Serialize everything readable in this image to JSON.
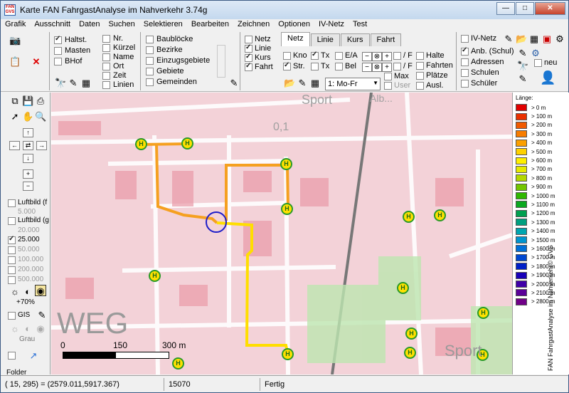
{
  "window": {
    "title": "Karte FAN FahrgastAnalyse im Nahverkehr 3.74g",
    "app_icon_text": "FAN GVS",
    "minimize": "—",
    "maximize": "□",
    "close": "✕"
  },
  "menu": [
    "Grafik",
    "Ausschnitt",
    "Daten",
    "Suchen",
    "Selektieren",
    "Bearbeiten",
    "Zeichnen",
    "Optionen",
    "IV-Netz",
    "Test"
  ],
  "toolbar": {
    "group1": [
      {
        "label": "Haltst.",
        "checked": true
      },
      {
        "label": "Masten",
        "checked": false
      },
      {
        "label": "BHof",
        "checked": false
      }
    ],
    "group2": [
      {
        "label": "Nr.",
        "checked": false
      },
      {
        "label": "Kürzel",
        "checked": false
      },
      {
        "label": "Name",
        "checked": false
      },
      {
        "label": "Ort",
        "checked": false
      },
      {
        "label": "Zeit",
        "checked": false
      },
      {
        "label": "Linien",
        "checked": false
      }
    ],
    "group3": [
      {
        "label": "Baublöcke",
        "checked": false
      },
      {
        "label": "Bezirke",
        "checked": false
      },
      {
        "label": "Einzugsgebiete",
        "checked": false
      },
      {
        "label": "Gebiete",
        "checked": false
      },
      {
        "label": "Gemeinden",
        "checked": false
      }
    ],
    "group4": [
      {
        "label": "Netz",
        "checked": false
      },
      {
        "label": "Linie",
        "checked": true
      },
      {
        "label": "Kurs",
        "checked": true
      },
      {
        "label": "Fahrt",
        "checked": true
      }
    ],
    "tabs": [
      "Netz",
      "Linie",
      "Kurs",
      "Fahrt"
    ],
    "tab_active": "Netz",
    "netz_options": {
      "kno": "Kno",
      "str": "Str.",
      "tx1": "Tx",
      "tx2": "Tx",
      "ea": "E/A",
      "bel": "Bel",
      "f1": "/ F",
      "f2": "/ F",
      "max": "Max",
      "user": "User",
      "halte": "Halte",
      "fahrten": "Fahrten",
      "platze": "Plätze",
      "ausl": "Ausl."
    },
    "day_select": "1: Mo-Fr",
    "group5": [
      {
        "label": "IV-Netz",
        "checked": false
      },
      {
        "label": "Anb. (Schul)",
        "checked": true
      },
      {
        "label": "Adressen",
        "checked": false
      },
      {
        "label": "Schulen",
        "checked": false
      },
      {
        "label": "Schüler",
        "checked": false
      }
    ],
    "neu_label": "neu"
  },
  "sidebar": {
    "luftbild1": "Luftbild (f",
    "scale_5000": "5.000",
    "luftbild2": "Luftbild (g",
    "scale_20000": "20.000",
    "scale_25000": "25.000",
    "scale_50000": "50.000",
    "scale_100000": "100.000",
    "scale_200000": "200.000",
    "scale_500000": "500.000",
    "contrast": "+70%",
    "gis": "GIS",
    "grau": "Grau",
    "folder": "Folder"
  },
  "map": {
    "labels": {
      "sport_top": "Sport",
      "sport_bottom": "Sport",
      "weg": "WEG",
      "top_text": "Alb...",
      "km": "0,1"
    },
    "scalebar": {
      "t0": "0",
      "t150": "150",
      "t300": "300 m"
    }
  },
  "legend": {
    "title": "Länge:",
    "vertical_text": "FAN FahrgastAnalyse im Nahverkehr© GVS",
    "items": [
      {
        "label": "> 0 m",
        "color": "#e00000"
      },
      {
        "label": "> 100 m",
        "color": "#ea3000"
      },
      {
        "label": "> 200 m",
        "color": "#f05a00"
      },
      {
        "label": "> 300 m",
        "color": "#f87d00"
      },
      {
        "label": "> 400 m",
        "color": "#fca000"
      },
      {
        "label": "> 500 m",
        "color": "#ffd200"
      },
      {
        "label": "> 600 m",
        "color": "#ffef00"
      },
      {
        "label": "> 700 m",
        "color": "#e6ea00"
      },
      {
        "label": "> 800 m",
        "color": "#b4d800"
      },
      {
        "label": "> 900 m",
        "color": "#73c600"
      },
      {
        "label": "> 1000 m",
        "color": "#2fb800"
      },
      {
        "label": "> 1100 m",
        "color": "#0aa820"
      },
      {
        "label": "> 1200 m",
        "color": "#00a050"
      },
      {
        "label": "> 1300 m",
        "color": "#00a080"
      },
      {
        "label": "> 1400 m",
        "color": "#00a6b0"
      },
      {
        "label": "> 1500 m",
        "color": "#0096d0"
      },
      {
        "label": "> 1600 m",
        "color": "#0070d8"
      },
      {
        "label": "> 1700 m",
        "color": "#0048d0"
      },
      {
        "label": "> 1800 m",
        "color": "#0020c8"
      },
      {
        "label": "> 1900 m",
        "color": "#1800b8"
      },
      {
        "label": "> 2000 m",
        "color": "#4000a8"
      },
      {
        "label": "> 2100 m",
        "color": "#5a0098"
      },
      {
        "label": "> 2800 m",
        "color": "#700088"
      }
    ]
  },
  "status": {
    "coords": "( 15, 295) = (2579.011,5917.367)",
    "value": "15070",
    "state": "Fertig"
  }
}
